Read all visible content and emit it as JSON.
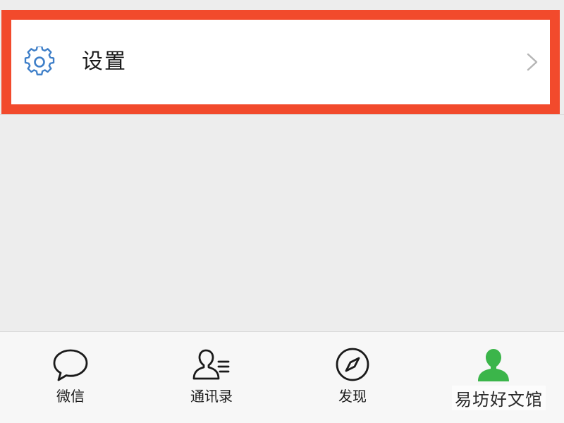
{
  "settings_row": {
    "label": "设置",
    "icon": "gear-icon",
    "highlight_color": "#f24a2c"
  },
  "tabbar": {
    "tabs": [
      {
        "label": "微信",
        "icon": "chat-bubble-icon",
        "active": false
      },
      {
        "label": "通讯录",
        "icon": "contacts-icon",
        "active": false
      },
      {
        "label": "发现",
        "icon": "compass-icon",
        "active": false
      },
      {
        "label": "",
        "icon": "profile-person-icon",
        "active": true,
        "active_color": "#3bb54a"
      }
    ]
  },
  "watermark": {
    "text": "易坊好文馆"
  },
  "colors": {
    "background": "#ededed",
    "gear_blue": "#3d7ec8",
    "tab_active_green": "#3bb54a"
  }
}
